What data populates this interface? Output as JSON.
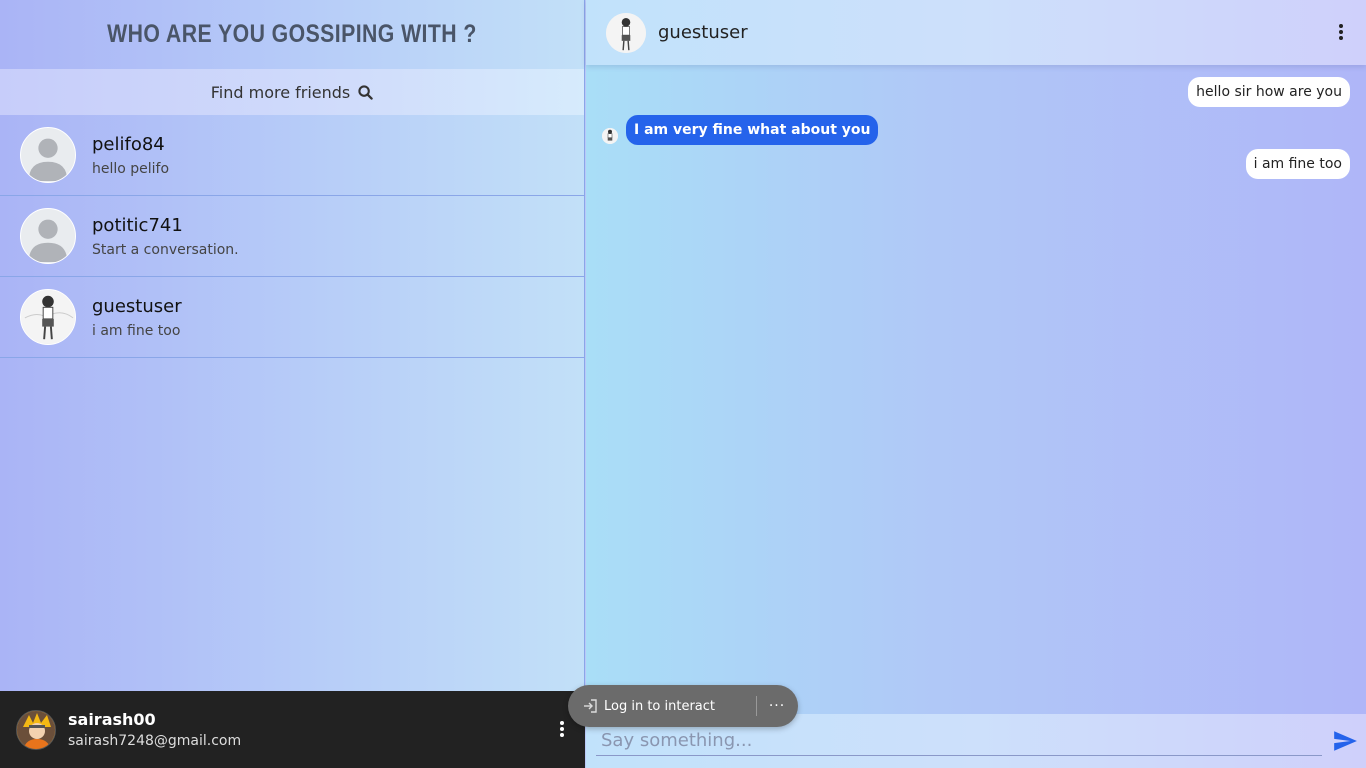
{
  "sidebar": {
    "title": "WHO ARE YOU GOSSIPING WITH ?",
    "find_label": "Find more friends",
    "conversations": [
      {
        "name": "pelifo84",
        "last": "hello pelifo"
      },
      {
        "name": "potitic741",
        "last": "Start a conversation."
      },
      {
        "name": "guestuser",
        "last": "i am fine too"
      }
    ],
    "me": {
      "name": "sairash00",
      "email": "sairash7248@gmail.com"
    }
  },
  "chat": {
    "peer_name": "guestuser",
    "messages": [
      {
        "text": "hello sir how are you",
        "dir": "out"
      },
      {
        "text": "I am very fine what about you",
        "dir": "in"
      },
      {
        "text": "i am fine too",
        "dir": "out"
      }
    ],
    "composer_placeholder": "Say something..."
  },
  "overlay": {
    "login_label": "Log in to interact",
    "more_label": "···"
  },
  "colors": {
    "accent": "#2563eb",
    "footer_bg": "#222222"
  }
}
